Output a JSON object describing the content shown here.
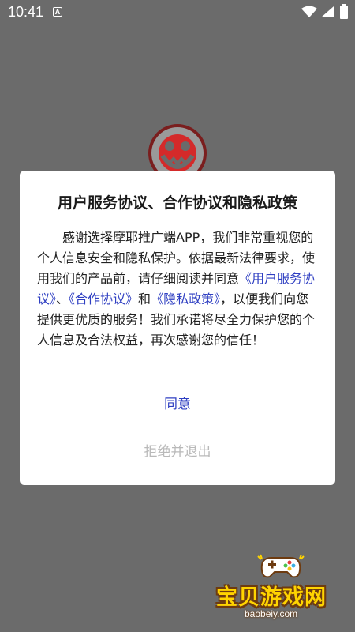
{
  "status_bar": {
    "time": "10:41",
    "notification_icon": "A"
  },
  "dialog": {
    "title": "用户服务协议、合作协议和隐私政策",
    "body": {
      "intro": "感谢选择摩耶推广端APP，我们非常重视您的个人信息安全和隐私保护。依据最新法律要求，使用我们的产品前，请仔细阅读并同意",
      "link_user_agreement": "《用户服务协议》",
      "sep1": "、",
      "link_cooperation": "《合作协议》",
      "sep2": "和",
      "link_privacy": "《隐私政策》",
      "outro": "，以便我们向您提供更优质的服务！我们承诺将尽全力保护您的个人信息及合法权益，再次感谢您的信任！"
    },
    "agree_label": "同意",
    "reject_label": "拒绝并退出"
  },
  "watermark": {
    "title": "宝贝游戏网",
    "domain": "baobeiy.com"
  },
  "colors": {
    "overlay": "#6b6b6b",
    "link": "#2f3fc2",
    "disabled_text": "#b9b9b9",
    "logo_red": "#d42a2a"
  }
}
